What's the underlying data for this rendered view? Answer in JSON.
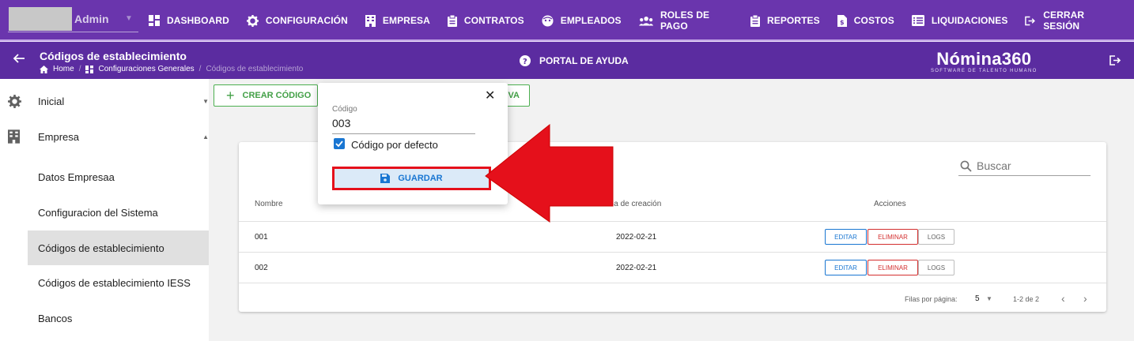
{
  "user": {
    "name": "Admin"
  },
  "nav": [
    {
      "label": "DASHBOARD",
      "icon": "dashboard-icon"
    },
    {
      "label": "CONFIGURACIÓN",
      "icon": "gear-icon"
    },
    {
      "label": "EMPRESA",
      "icon": "building-icon"
    },
    {
      "label": "CONTRATOS",
      "icon": "clipboard-icon"
    },
    {
      "label": "EMPLEADOS",
      "icon": "face-icon"
    },
    {
      "label": "ROLES DE PAGO",
      "icon": "people-icon"
    },
    {
      "label": "REPORTES",
      "icon": "clipboard-icon"
    },
    {
      "label": "COSTOS",
      "icon": "receipt-icon"
    },
    {
      "label": "LIQUIDACIONES",
      "icon": "list-icon"
    },
    {
      "label": "CERRAR SESIÓN",
      "icon": "logout-icon"
    }
  ],
  "header": {
    "title": "Códigos de establecimiento",
    "breadcrumb": [
      "Home",
      "Configuraciones Generales",
      "Códigos de establecimiento"
    ],
    "help": "PORTAL DE AYUDA",
    "brand": "Nómina360",
    "brand_tagline": "SOFTWARE DE TALENTO HUMANO"
  },
  "sidebar": {
    "items": [
      {
        "label": "Inicial"
      },
      {
        "label": "Empresa"
      },
      {
        "label": "Datos Empresaa"
      },
      {
        "label": "Configuracion del Sistema"
      },
      {
        "label": "Códigos de establecimiento"
      },
      {
        "label": "Códigos de establecimiento IESS"
      },
      {
        "label": "Bancos"
      }
    ]
  },
  "toolbar": {
    "create_label": "CREAR CÓDIGO",
    "partial_label": "VA"
  },
  "table": {
    "search_placeholder": "Buscar",
    "headers": {
      "name": "Nombre",
      "date": "Fecha de creación",
      "actions": "Acciones"
    },
    "rows": [
      {
        "name": "001",
        "date": "2022-02-21"
      },
      {
        "name": "002",
        "date": "2022-02-21"
      }
    ],
    "actions": {
      "edit": "EDITAR",
      "delete": "ELIMINAR",
      "logs": "LOGS"
    },
    "footer": {
      "rows_per_page_label": "Filas por página:",
      "rows_per_page": "5",
      "range": "1-2 de 2"
    }
  },
  "popup": {
    "field_label": "Código",
    "field_value": "003",
    "checkbox_label": "Código por defecto",
    "checkbox_checked": true,
    "save_label": "GUARDAR"
  },
  "colors": {
    "topbar": "#6a35ad",
    "subbar": "#5b2ca0",
    "accent": "#1976d2",
    "arrow": "#e5101b",
    "success": "#43a047"
  }
}
